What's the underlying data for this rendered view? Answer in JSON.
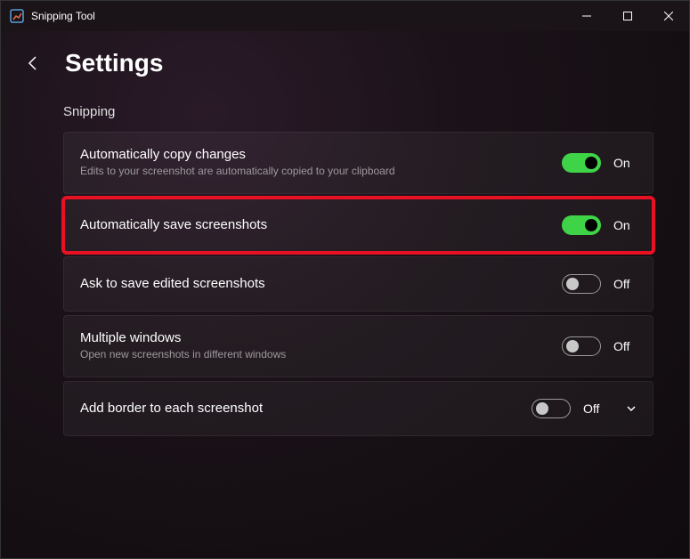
{
  "window": {
    "title": "Snipping Tool"
  },
  "header": {
    "title": "Settings"
  },
  "section": {
    "title": "Snipping"
  },
  "settings": [
    {
      "title": "Automatically copy changes",
      "desc": "Edits to your screenshot are automatically copied to your clipboard",
      "state": "on",
      "state_label": "On",
      "highlighted": false,
      "expandable": false
    },
    {
      "title": "Automatically save screenshots",
      "desc": "",
      "state": "on",
      "state_label": "On",
      "highlighted": true,
      "expandable": false
    },
    {
      "title": "Ask to save edited screenshots",
      "desc": "",
      "state": "off",
      "state_label": "Off",
      "highlighted": false,
      "expandable": false
    },
    {
      "title": "Multiple windows",
      "desc": "Open new screenshots in different windows",
      "state": "off",
      "state_label": "Off",
      "highlighted": false,
      "expandable": false
    },
    {
      "title": "Add border to each screenshot",
      "desc": "",
      "state": "off",
      "state_label": "Off",
      "highlighted": false,
      "expandable": true
    }
  ]
}
